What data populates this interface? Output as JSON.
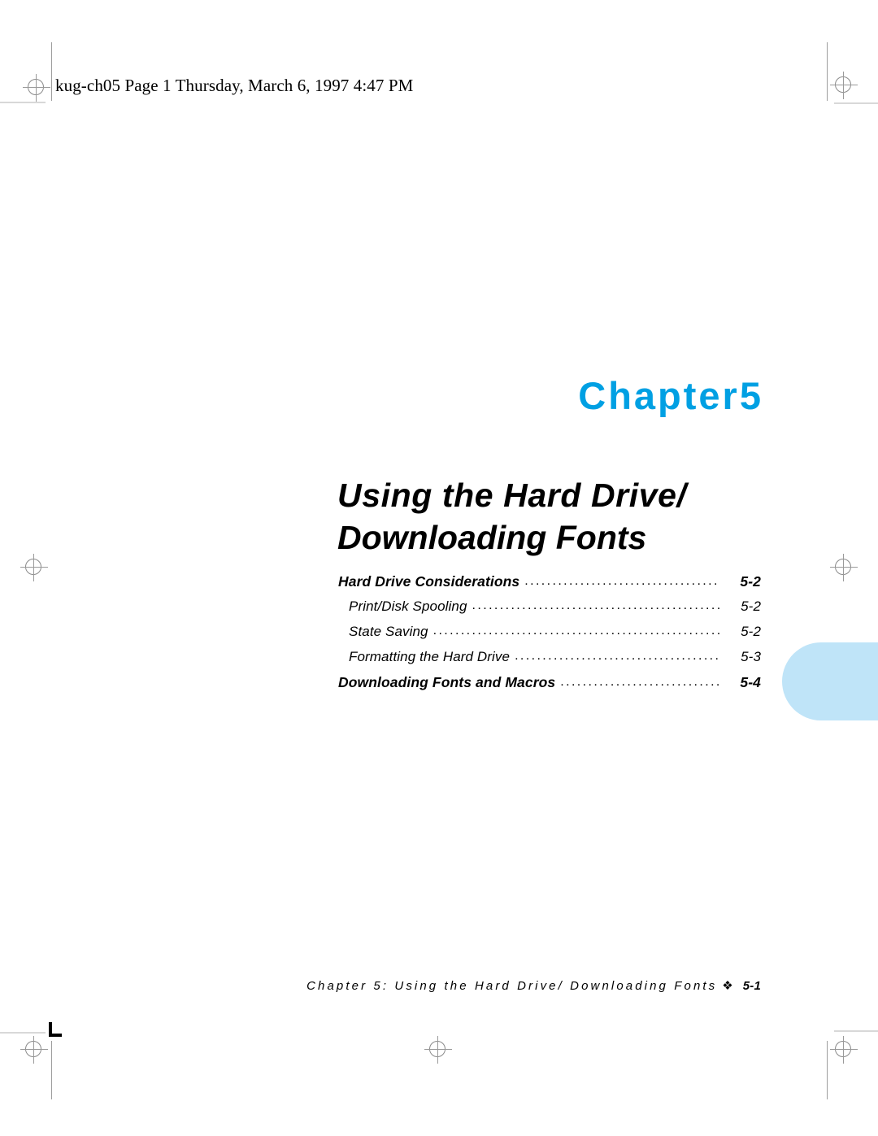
{
  "header": {
    "text": "kug-ch05  Page 1  Thursday, March 6, 1997  4:47 PM"
  },
  "chapter": {
    "label_word": "Chapter",
    "number": "5",
    "title_line_1": "Using the Hard Drive/",
    "title_line_2": "Downloading Fonts",
    "accent_color": "#00a0e3",
    "tab_color": "#bfe4f8"
  },
  "toc": {
    "entries": [
      {
        "label": "Hard Drive Considerations",
        "page": "5-2",
        "level": 1
      },
      {
        "label": "Print/Disk Spooling",
        "page": "5-2",
        "level": 2
      },
      {
        "label": "State Saving",
        "page": "5-2",
        "level": 2
      },
      {
        "label": "Formatting the Hard Drive",
        "page": "5-3",
        "level": 2
      },
      {
        "label": "Downloading Fonts and Macros",
        "page": "5-4",
        "level": 1
      }
    ],
    "leader": "....................................................................................................."
  },
  "footer": {
    "text": "Chapter 5: Using the Hard Drive/ Downloading Fonts",
    "diamond": "❖",
    "page": "5-1"
  }
}
